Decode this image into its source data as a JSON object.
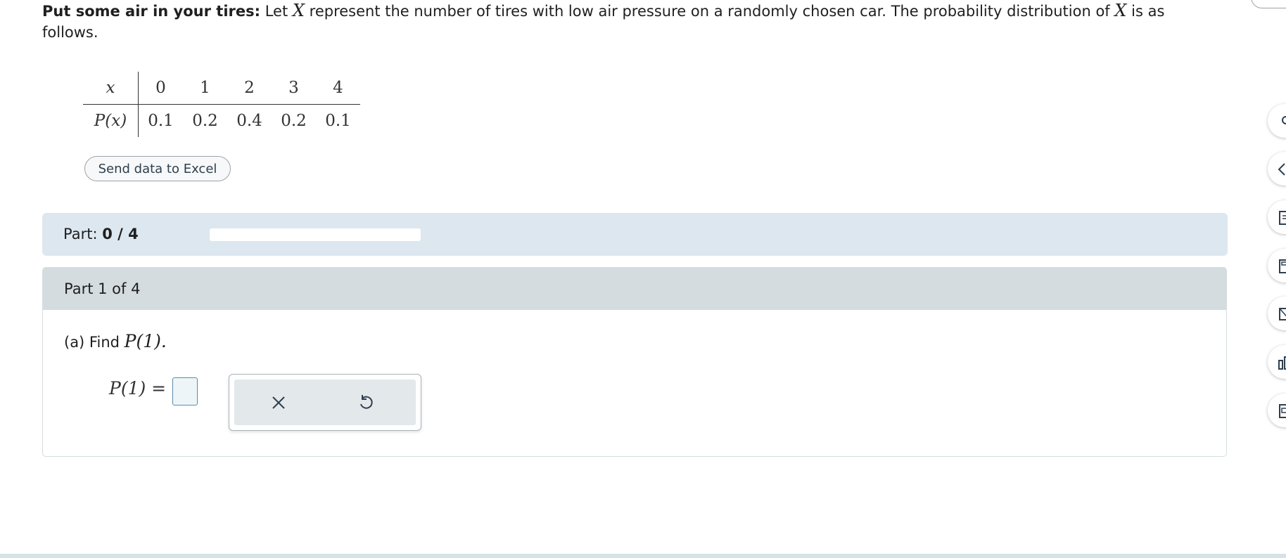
{
  "problem": {
    "title": "Put some air in your tires:",
    "text_1": " Let ",
    "var_x": "X",
    "text_2": " represent the number of tires with low air pressure on a randomly chosen car. The probability distribution of ",
    "var_x2": "X",
    "text_3": " is as follows."
  },
  "table": {
    "row1_label": "x",
    "row2_label": "P(x)",
    "x_values": [
      "0",
      "1",
      "2",
      "3",
      "4"
    ],
    "p_values": [
      "0.1",
      "0.2",
      "0.4",
      "0.2",
      "0.1"
    ]
  },
  "excel_button": "Send data to Excel",
  "part_bar": {
    "label": "Part: ",
    "progress": "0 / 4",
    "progress_fraction": 0
  },
  "part": {
    "heading": "Part 1 of 4",
    "question_prefix": "(a) Find ",
    "question_math": "P(1).",
    "answer_label": "P(1) =",
    "answer_value": ""
  },
  "tools": {
    "clear_icon": "x-icon",
    "undo_icon": "undo-icon"
  },
  "edge_icons": [
    "search-icon",
    "eraser-icon",
    "notes-icon",
    "calculator-icon",
    "message-icon",
    "chart-icon",
    "book-icon"
  ],
  "colors": {
    "part_bar_bg": "#dde7f0",
    "part_header_bg": "#d4dcdf",
    "input_border": "#5c8aa8"
  }
}
